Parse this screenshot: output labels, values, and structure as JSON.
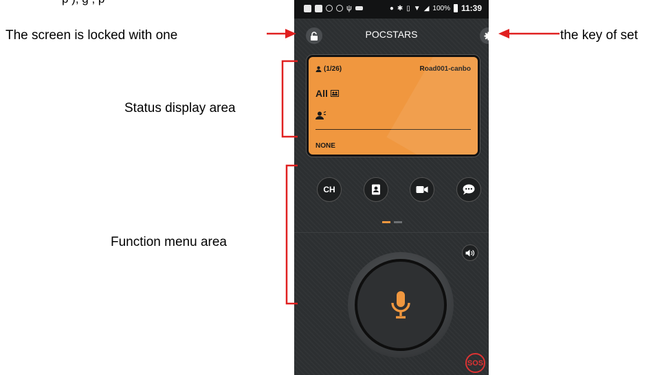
{
  "cut_text": "p               ),                    g         ,                       p",
  "annotations": {
    "lock_text": "The   screen   is   locked   with   one",
    "settings_text": "the key of set",
    "status_area": "Status display area",
    "function_area": "Function menu area"
  },
  "phone": {
    "status_bar": {
      "battery": "100%",
      "time": "11:39"
    },
    "title": "POCSTARS",
    "status": {
      "count": "(1/26)",
      "name": "Road001-canbo",
      "group": "All",
      "bottom": "NONE"
    },
    "functions": {
      "ch_label": "CH"
    },
    "sos_label": "SOS"
  },
  "colors": {
    "accent": "#f0973f",
    "arrow": "#e02020",
    "sos": "#dd3333"
  }
}
